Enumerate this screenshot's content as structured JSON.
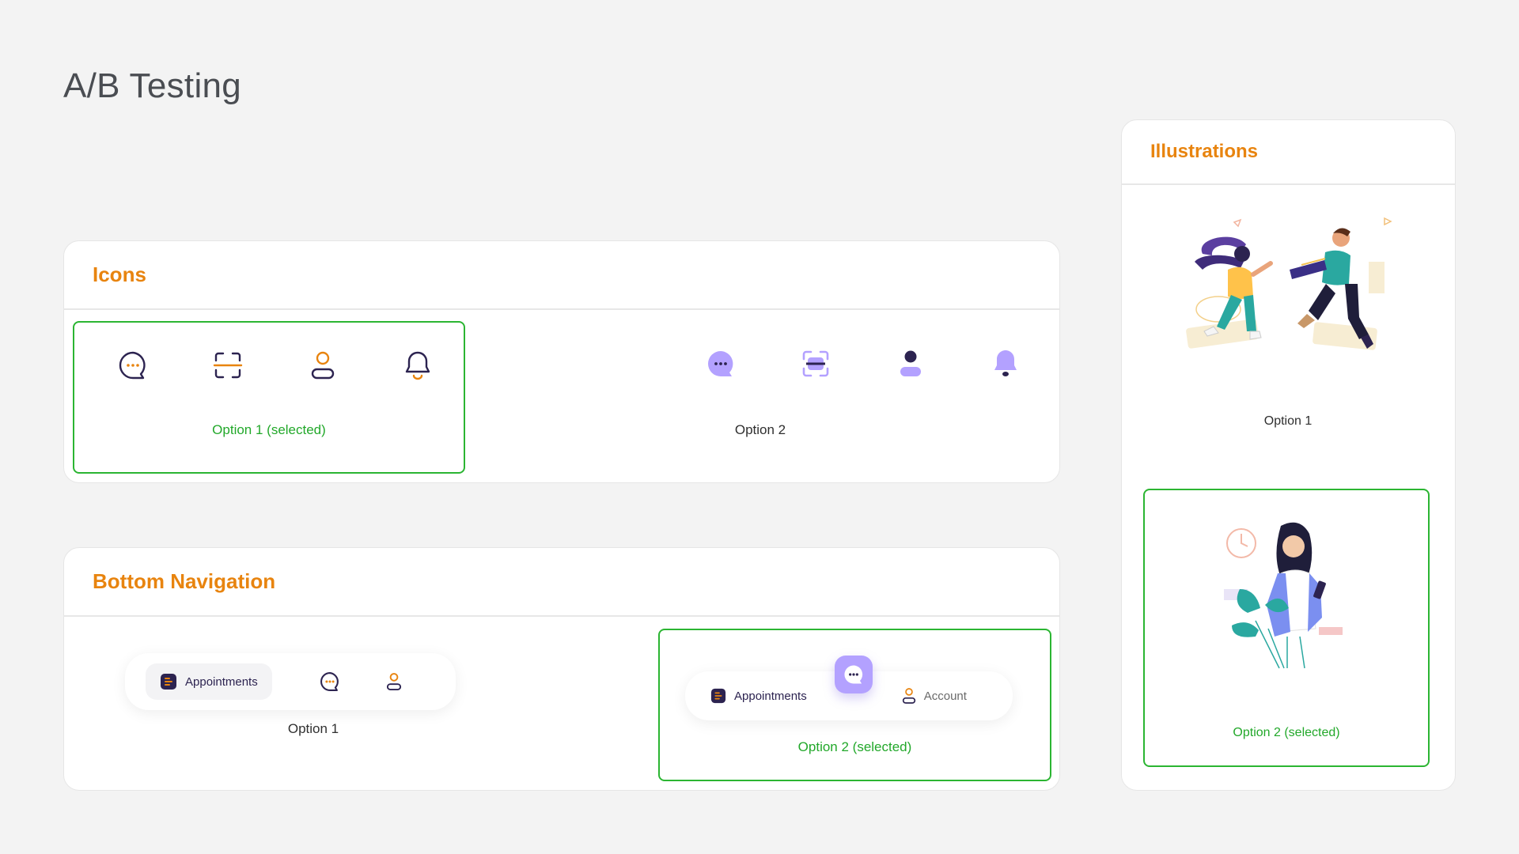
{
  "page": {
    "title": "A/B Testing"
  },
  "colors": {
    "accent": "#e8840f",
    "selected": "#2bb532",
    "navy": "#2c2350",
    "lavender": "#b3a1ff"
  },
  "icons_panel": {
    "title": "Icons",
    "option1": {
      "label": "Option 1 (selected)",
      "icons": [
        "chat-outline-icon",
        "scan-outline-icon",
        "user-outline-icon",
        "bell-outline-icon"
      ]
    },
    "option2": {
      "label": "Option 2",
      "icons": [
        "chat-filled-icon",
        "scan-filled-icon",
        "user-filled-icon",
        "bell-filled-icon"
      ]
    }
  },
  "nav_panel": {
    "title": "Bottom Navigation",
    "option1": {
      "label": "Option 1",
      "active_item": "Appointments"
    },
    "option2": {
      "label": "Option 2 (selected)",
      "item1": "Appointments",
      "item2": "Account"
    }
  },
  "illustrations_panel": {
    "title": "Illustrations",
    "option1": {
      "label": "Option 1"
    },
    "option2": {
      "label": "Option 2 (selected)"
    }
  }
}
